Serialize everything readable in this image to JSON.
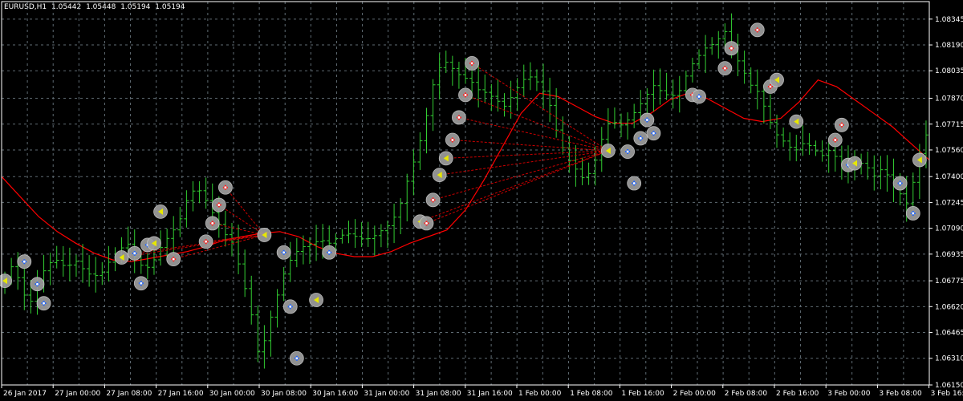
{
  "header": {
    "symbol": "EURUSD,H1",
    "open": "1.05442",
    "high": "1.05448",
    "low": "1.05194",
    "close": "1.05194"
  },
  "colors": {
    "background": "#000000",
    "grid": "#5f6b73",
    "axis": "#ffffff",
    "bar_up": "#32cd32",
    "bar_down": "#32cd32",
    "moving_average": "#ff0000",
    "fan_lines": "#cc0000",
    "marker_bg": "#9e9e9e",
    "buy_marker": "#1e64ff",
    "sell_marker": "#ff2020",
    "exit_marker": "#e8e800"
  },
  "chart_data": {
    "type": "line",
    "title": "EURUSD,H1",
    "grid": true,
    "ylim": [
      1.0615,
      1.0845
    ],
    "y_ticks": [
      "1.08345",
      "1.08190",
      "1.08035",
      "1.07870",
      "1.07715",
      "1.07560",
      "1.07400",
      "1.07245",
      "1.07090",
      "1.06935",
      "1.06775",
      "1.06620",
      "1.06465",
      "1.06310",
      "1.06150"
    ],
    "x_ticks": [
      "26 Jan 2017",
      "27 Jan 00:00",
      "27 Jan 08:00",
      "27 Jan 16:00",
      "30 Jan 00:00",
      "30 Jan 08:00",
      "30 Jan 16:00",
      "31 Jan 00:00",
      "31 Jan 08:00",
      "31 Jan 16:00",
      "1 Feb 00:00",
      "1 Feb 08:00",
      "1 Feb 16:00",
      "2 Feb 00:00",
      "2 Feb 08:00",
      "2 Feb 16:00",
      "3 Feb 00:00",
      "3 Feb 08:00",
      "3 Feb 16:00"
    ],
    "price_series": [
      {
        "name": "",
        "values": [
          1.068,
          1.0688,
          1.067,
          1.0665,
          1.068,
          1.0688,
          1.069,
          1.0685,
          1.069,
          1.0684,
          1.068,
          1.0682,
          1.069,
          1.0696,
          1.07,
          1.069,
          1.0684,
          1.069,
          1.07,
          1.0706,
          1.0715,
          1.073,
          1.0733,
          1.0725,
          1.0715,
          1.0706,
          1.07,
          1.068,
          1.066,
          1.063,
          1.065,
          1.0668,
          1.0685,
          1.0694,
          1.0698,
          1.07,
          1.0702,
          1.07,
          1.0704,
          1.0706,
          1.0704,
          1.0702,
          1.0704,
          1.0708,
          1.0712,
          1.0722,
          1.074,
          1.0755,
          1.0775,
          1.08,
          1.081,
          1.0805,
          1.08,
          1.0798,
          1.0792,
          1.079,
          1.0786,
          1.0782,
          1.079,
          1.0798,
          1.08,
          1.0795,
          1.0785,
          1.0765,
          1.0752,
          1.0745,
          1.0738,
          1.0745,
          1.0762,
          1.0775,
          1.077,
          1.0774,
          1.078,
          1.0788,
          1.0795,
          1.079,
          1.0788,
          1.0792,
          1.0805,
          1.0812,
          1.0818,
          1.082,
          1.0828,
          1.0815,
          1.0805,
          1.0795,
          1.079,
          1.0775,
          1.0765,
          1.076,
          1.0755,
          1.076,
          1.0758,
          1.0752,
          1.0756,
          1.075,
          1.0745,
          1.0748,
          1.0748,
          1.074,
          1.0745,
          1.0738,
          1.073,
          1.0722,
          1.075,
          1.0765
        ]
      }
    ],
    "moving_average": [
      1.074,
      1.0728,
      1.0716,
      1.0707,
      1.07,
      1.0694,
      1.069,
      1.0689,
      1.0691,
      1.0693,
      1.0695,
      1.0698,
      1.0702,
      1.0704,
      1.0706,
      1.0707,
      1.0704,
      1.0698,
      1.0694,
      1.0692,
      1.0692,
      1.0695,
      1.07,
      1.0704,
      1.0708,
      1.072,
      1.0738,
      1.0758,
      1.0778,
      1.079,
      1.0788,
      1.0782,
      1.0776,
      1.0772,
      1.0772,
      1.0778,
      1.0786,
      1.079,
      1.0787,
      1.0781,
      1.0775,
      1.0773,
      1.0775,
      1.0785,
      1.0798,
      1.0794,
      1.0786,
      1.0778,
      1.077,
      1.076,
      1.075
    ],
    "markers": [
      {
        "x": 0,
        "y": 1.06775,
        "kind": "exit"
      },
      {
        "x": 3,
        "y": 1.0689,
        "kind": "buy"
      },
      {
        "x": 5,
        "y": 1.06755,
        "kind": "buy"
      },
      {
        "x": 6,
        "y": 1.0664,
        "kind": "buy"
      },
      {
        "x": 18,
        "y": 1.06915,
        "kind": "exit"
      },
      {
        "x": 20,
        "y": 1.0694,
        "kind": "buy"
      },
      {
        "x": 21,
        "y": 1.0676,
        "kind": "buy"
      },
      {
        "x": 22,
        "y": 1.0699,
        "kind": "buy"
      },
      {
        "x": 23,
        "y": 1.07,
        "kind": "exit"
      },
      {
        "x": 24,
        "y": 1.0719,
        "kind": "exit"
      },
      {
        "x": 26,
        "y": 1.06905,
        "kind": "sell"
      },
      {
        "x": 31,
        "y": 1.0701,
        "kind": "sell"
      },
      {
        "x": 32,
        "y": 1.0712,
        "kind": "sell"
      },
      {
        "x": 33,
        "y": 1.0723,
        "kind": "sell"
      },
      {
        "x": 34,
        "y": 1.07335,
        "kind": "sell"
      },
      {
        "x": 40,
        "y": 1.0705,
        "kind": "exit"
      },
      {
        "x": 43,
        "y": 1.06945,
        "kind": "buy"
      },
      {
        "x": 44,
        "y": 1.0662,
        "kind": "buy"
      },
      {
        "x": 45,
        "y": 1.0631,
        "kind": "buy"
      },
      {
        "x": 48,
        "y": 1.0666,
        "kind": "exit"
      },
      {
        "x": 50,
        "y": 1.06945,
        "kind": "buy"
      },
      {
        "x": 64,
        "y": 1.0713,
        "kind": "exit"
      },
      {
        "x": 65,
        "y": 1.0712,
        "kind": "sell"
      },
      {
        "x": 66,
        "y": 1.0726,
        "kind": "sell"
      },
      {
        "x": 67,
        "y": 1.0741,
        "kind": "exit"
      },
      {
        "x": 68,
        "y": 1.0751,
        "kind": "exit"
      },
      {
        "x": 69,
        "y": 1.0762,
        "kind": "sell"
      },
      {
        "x": 70,
        "y": 1.07755,
        "kind": "sell"
      },
      {
        "x": 71,
        "y": 1.0789,
        "kind": "sell"
      },
      {
        "x": 72,
        "y": 1.0808,
        "kind": "sell"
      },
      {
        "x": 93,
        "y": 1.07555,
        "kind": "exit"
      },
      {
        "x": 96,
        "y": 1.0755,
        "kind": "buy"
      },
      {
        "x": 97,
        "y": 1.0736,
        "kind": "buy"
      },
      {
        "x": 98,
        "y": 1.0763,
        "kind": "buy"
      },
      {
        "x": 99,
        "y": 1.0774,
        "kind": "buy"
      },
      {
        "x": 100,
        "y": 1.0766,
        "kind": "buy"
      },
      {
        "x": 106,
        "y": 1.0789,
        "kind": "sell"
      },
      {
        "x": 107,
        "y": 1.0788,
        "kind": "buy"
      },
      {
        "x": 111,
        "y": 1.0805,
        "kind": "sell"
      },
      {
        "x": 112,
        "y": 1.0817,
        "kind": "sell"
      },
      {
        "x": 116,
        "y": 1.0828,
        "kind": "sell"
      },
      {
        "x": 118,
        "y": 1.0794,
        "kind": "sell"
      },
      {
        "x": 119,
        "y": 1.0798,
        "kind": "exit"
      },
      {
        "x": 122,
        "y": 1.0773,
        "kind": "exit"
      },
      {
        "x": 128,
        "y": 1.0762,
        "kind": "sell"
      },
      {
        "x": 129,
        "y": 1.0771,
        "kind": "sell"
      },
      {
        "x": 130,
        "y": 1.0747,
        "kind": "buy"
      },
      {
        "x": 131,
        "y": 1.0748,
        "kind": "exit"
      },
      {
        "x": 138,
        "y": 1.0736,
        "kind": "buy"
      },
      {
        "x": 140,
        "y": 1.0718,
        "kind": "buy"
      },
      {
        "x": 141,
        "y": 1.075,
        "kind": "exit"
      }
    ],
    "fans": [
      {
        "to_x": 40,
        "to_y": 1.0705,
        "from": [
          26,
          31,
          32,
          33,
          34,
          18,
          20
        ]
      },
      {
        "to_x": 93,
        "to_y": 1.07555,
        "from": [
          64,
          65,
          66,
          67,
          68,
          69,
          70,
          71,
          72
        ]
      }
    ]
  }
}
